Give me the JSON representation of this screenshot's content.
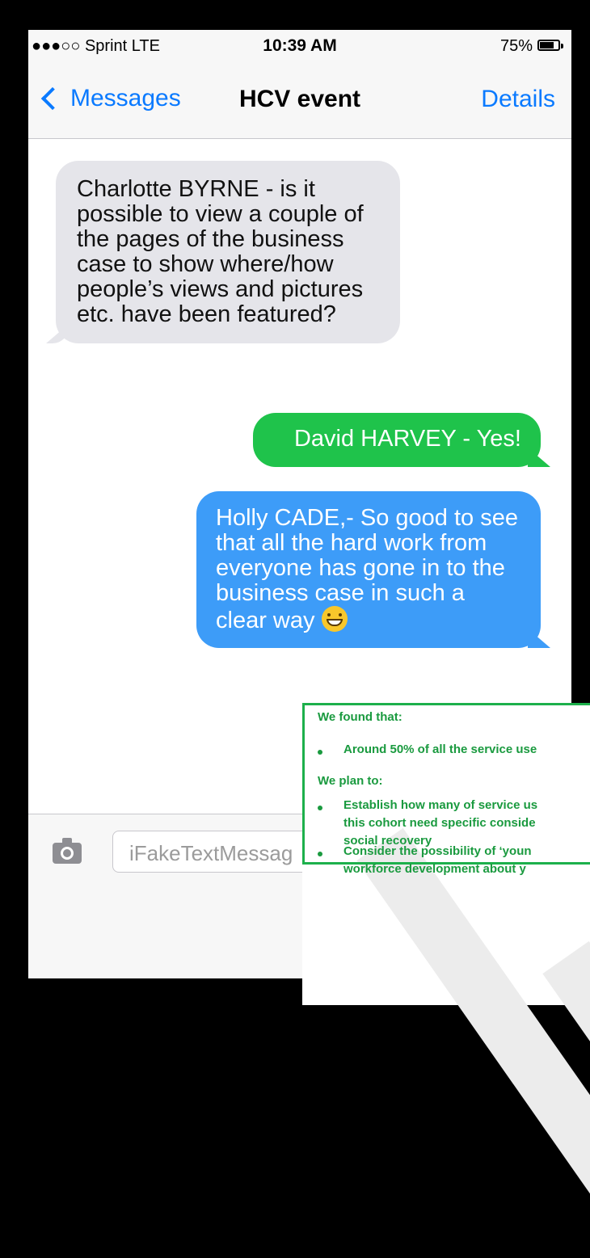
{
  "status_bar": {
    "carrier": "●●●○○ Sprint  LTE",
    "time": "10:39 AM",
    "battery_text": "75%",
    "battery_level": 0.75
  },
  "nav": {
    "back_label": "Messages",
    "title": "HCV event",
    "details_label": "Details"
  },
  "messages": [
    {
      "type": "received",
      "text": "Charlotte BYRNE - is it possible to view a couple of the pages of the business case to show where/how people’s views and pictures etc. have been featured?"
    },
    {
      "type": "sent",
      "color": "#1fc34b",
      "text": "David HARVEY - Yes!"
    },
    {
      "type": "sent",
      "color": "#3d9cf8",
      "text": "Holly CADE,- So good to see that all the hard work from everyone has gone in to the business case in such a clear way",
      "emoji": "grinning-face-icon"
    }
  ],
  "composer": {
    "placeholder": "iFakeTextMessag",
    "camera_icon": "camera-icon"
  },
  "document": {
    "border_color": "#1db04b",
    "heading_found": "We found that:",
    "found_item": "Around 50% of all the service use",
    "heading_plan": "We plan to:",
    "plan_item_1_lines": [
      "Establish how many of service us",
      "this cohort need specific conside",
      "social recovery"
    ],
    "plan_item_2_lines": [
      "Consider the possibility of ‘youn",
      "workforce development about y"
    ]
  }
}
